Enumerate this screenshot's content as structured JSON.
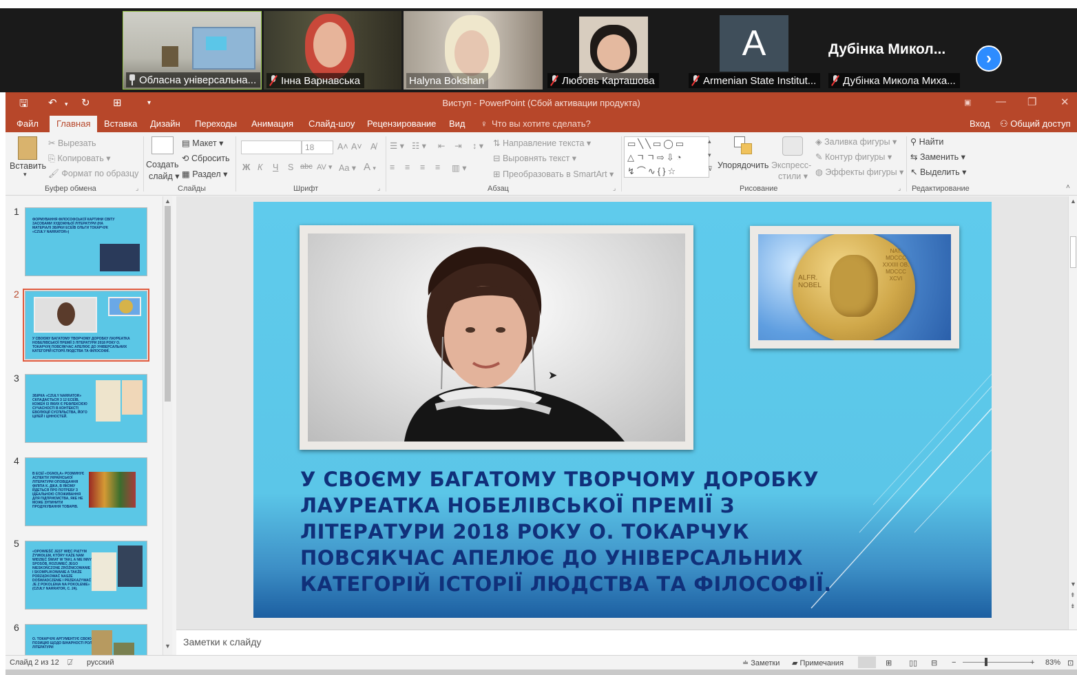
{
  "participants": [
    {
      "name": "Обласна універсальна...",
      "icon": "pin-icon",
      "muted": false
    },
    {
      "name": "Інна Варнавська",
      "icon": "mic-muted-icon",
      "muted": true
    },
    {
      "name": "Halyna Bokshan",
      "icon": "",
      "muted": false
    },
    {
      "name": "Любовь Карташова",
      "icon": "mic-muted-icon",
      "muted": true
    },
    {
      "name": "Armenian State Institut...",
      "icon": "mic-muted-icon",
      "muted": true,
      "avatar_letter": "A"
    },
    {
      "name": "Дубінка Микола Миха...",
      "icon": "mic-muted-icon",
      "muted": true,
      "big_label": "Дубінка Микол..."
    }
  ],
  "window": {
    "title": "Виступ - PowerPoint (Сбой активации продукта)"
  },
  "menu": {
    "file": "Файл",
    "tabs": [
      "Главная",
      "Вставка",
      "Дизайн",
      "Переходы",
      "Анимация",
      "Слайд-шоу",
      "Рецензирование",
      "Вид"
    ],
    "active_tab": "Главная",
    "tell_me": "Что вы хотите сделать?",
    "login": "Вход",
    "share": "Общий доступ"
  },
  "ribbon": {
    "clipboard": {
      "label": "Буфер обмена",
      "paste": "Вставить",
      "cut": "Вырезать",
      "copy": "Копировать",
      "format_painter": "Формат по образцу"
    },
    "slides": {
      "label": "Слайды",
      "new_slide_1": "Создать",
      "new_slide_2": "слайд",
      "layout": "Макет",
      "reset": "Сбросить",
      "section": "Раздел"
    },
    "font": {
      "label": "Шрифт",
      "size": "18",
      "bold": "Ж",
      "italic": "К",
      "underline": "Ч",
      "shadow": "S",
      "strike": "abc",
      "spacing": "AV",
      "case": "Aa",
      "color": "A"
    },
    "paragraph": {
      "label": "Абзац",
      "text_direction": "Направление текста",
      "align_text": "Выровнять текст",
      "smartart": "Преобразовать в SmartArt"
    },
    "drawing": {
      "label": "Рисование",
      "arrange": "Упорядочить",
      "quick_styles_1": "Экспресс-",
      "quick_styles_2": "стили",
      "fill": "Заливка фигуры",
      "outline": "Контур фигуры",
      "effects": "Эффекты фигуры"
    },
    "editing": {
      "label": "Редактирование",
      "find": "Найти",
      "replace": "Заменить",
      "select": "Выделить"
    }
  },
  "thumbnails": [
    {
      "num": "1",
      "text": "ФОРМУВАННЯ ФІЛОСОФСЬКОЇ КАРТИНИ СВІТУ ЗАСОБАМИ ХУДОЖНЬОЇ ЛІТЕРАТУРИ (НА МАТЕРІАЛІ ЗБІРКИ ЕСЕЇВ ОЛЬГИ ТОКАРЧУК «CZUŁY NARRATOR»)"
    },
    {
      "num": "2",
      "text": "У СВОЄМУ БАГАТОМУ ТВОРЧОМУ ДОРОБКУ ЛАУРЕАТКА НОБЕЛІВСЬКОЇ ПРЕМІЇ З ЛІТЕРАТУРИ 2018 РОКУ О. ТОКАРЧУК ПОВСЯКЧАС АПЕЛЮЄ ДО УНІВЕРСАЛЬНИХ КАТЕГОРІЙ ІСТОРІЇ ЛЮДСТВА ТА ФІЛОСОФІЇ."
    },
    {
      "num": "3",
      "text": "ЗБІРКА «CZUŁY NARRATOR» СКЛАДАЄТЬСЯ З 12 ЕСЕЇВ, КОЖЕН ІЗ ЯКИХ Є РЕФЛЕКСІЄЮ СУЧАСНОСТІ В КОНТЕКСТІ ЕВОЛЮЦІЇ СУСПІЛЬСТВА, ЙОГО ЦІЛЕЙ І ЦІННОСТЕЙ."
    },
    {
      "num": "4",
      "text": "В ЕСЕЇ «OGNOLA» РОЗМИНУЄ АСПЕКТИ УКРАЇНСЬКОЇ ЛІТЕРАТУРИ ОПОВІДАННЯ ФІЛІПА К. ДІКА, В ЯКОМУ ЙДЕТЬСЯ ПРО ПОТРЕБУ З ІДЕАЛЬНОЮ СПОЖИВАННЯ ДЛЯ ПІДПРИЄМСТВА, ЯКЕ НЕ МОЖЕ ЗУПИНИТИ ПРОДУКУВАННЯ ТОВАРІВ."
    },
    {
      "num": "5",
      "text": "«OPOWIEŚĆ JEST WIĘC PIĄTYM ŻYWIOŁEM, KTÓRY KAŻE NAM WIDZIEĆ ŚWIAT W TAKI, A NIE INNY SPOSÓB, ROZUMIEĆ JEGO NIESKOŃCZONE ZRÓŻNICOWANIE I SKOMPLIKOWANIE A TAKŻE PORZĄDKOWAĆ NASZE DOŚWIADCZENIE I PRZEKAZYWAĆ JE Z POKOLENIA NA POKOLENIE» (CZUŁY NARRATOR, C. 24)."
    },
    {
      "num": "6",
      "text": "О. ТОКАРЧУК АРГУМЕНТУЄ СВОЮ ПОЗИЦІЮ ЩОДО БІНАРНОСТІ РОЛІ ЛІТЕРАТУРИ"
    }
  ],
  "slide": {
    "text": "У СВОЄМУ БАГАТОМУ ТВОРЧОМУ ДОРОБКУ ЛАУРЕАТКА НОБЕЛІВСЬКОЇ ПРЕМІЇ З ЛІТЕРАТУРИ 2018 РОКУ О. ТОКАРЧУК ПОВСЯКЧАС АПЕЛЮЄ ДО УНІВЕРСАЛЬНИХ КАТЕГОРІЙ ІСТОРІЇ ЛЮДСТВА ТА ФІЛОСОФІЇ.",
    "medal_text_1": "ALFR. NOBEL",
    "medal_text_2": "NAT. MDCCC XXXIII OB. MDCCC XCVI"
  },
  "notes": {
    "placeholder": "Заметки к слайду"
  },
  "status": {
    "slide_counter": "Слайд 2 из 12",
    "language": "русский",
    "notes_btn": "Заметки",
    "comments_btn": "Примечания",
    "zoom": "83%"
  },
  "colors": {
    "ppt_accent": "#b7472a",
    "slide_bg": "#5bc6e8",
    "slide_text": "#10307a",
    "zoom_next": "#2d8cff"
  }
}
